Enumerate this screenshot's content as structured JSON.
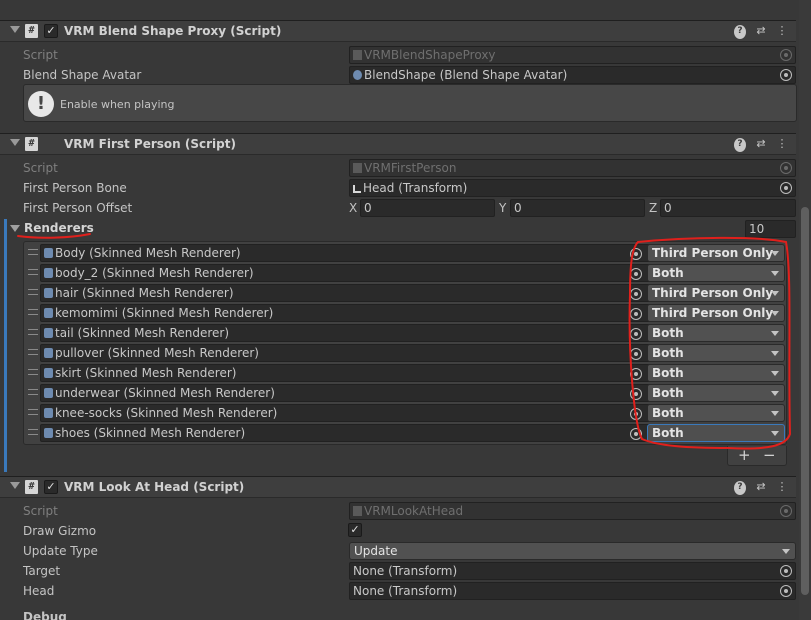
{
  "blend_shape_proxy": {
    "title": "VRM Blend Shape Proxy (Script)",
    "script_label": "Script",
    "script_value": "VRMBlendShapeProxy",
    "avatar_label": "Blend Shape Avatar",
    "avatar_value": "BlendShape (Blend Shape Avatar)",
    "help_message": "Enable when playing"
  },
  "first_person": {
    "title": "VRM First Person (Script)",
    "script_label": "Script",
    "script_value": "VRMFirstPerson",
    "bone_label": "First Person Bone",
    "bone_value": "Head (Transform)",
    "offset_label": "First Person Offset",
    "offset": {
      "x_label": "X",
      "x": "0",
      "y_label": "Y",
      "y": "0",
      "z_label": "Z",
      "z": "0"
    },
    "renderers_label": "Renderers",
    "renderers_count": "10",
    "renderers": [
      {
        "name": "Body (Skinned Mesh Renderer)",
        "mode": "Third Person Only"
      },
      {
        "name": "body_2 (Skinned Mesh Renderer)",
        "mode": "Both"
      },
      {
        "name": "hair (Skinned Mesh Renderer)",
        "mode": "Third Person Only"
      },
      {
        "name": "kemomimi (Skinned Mesh Renderer)",
        "mode": "Third Person Only"
      },
      {
        "name": "tail (Skinned Mesh Renderer)",
        "mode": "Both"
      },
      {
        "name": "pullover (Skinned Mesh Renderer)",
        "mode": "Both"
      },
      {
        "name": "skirt (Skinned Mesh Renderer)",
        "mode": "Both"
      },
      {
        "name": "underwear (Skinned Mesh Renderer)",
        "mode": "Both"
      },
      {
        "name": "knee-socks (Skinned Mesh Renderer)",
        "mode": "Both"
      },
      {
        "name": "shoes (Skinned Mesh Renderer)",
        "mode": "Both"
      }
    ],
    "add_label": "+",
    "remove_label": "−"
  },
  "look_at_head": {
    "title": "VRM Look At Head (Script)",
    "script_label": "Script",
    "script_value": "VRMLookAtHead",
    "gizmo_label": "Draw Gizmo",
    "gizmo_check": "✓",
    "update_type_label": "Update Type",
    "update_type_value": "Update",
    "target_label": "Target",
    "target_value": "None (Transform)",
    "head_label": "Head",
    "head_value": "None (Transform)",
    "debug_label": "Debug"
  },
  "icons": {
    "script": "#",
    "check": "✓",
    "help": "?",
    "presets": "⇄",
    "menu": "⋮",
    "warning": "!"
  },
  "colors": {
    "annotation": "#e0201c",
    "accent": "#3a79bb"
  }
}
